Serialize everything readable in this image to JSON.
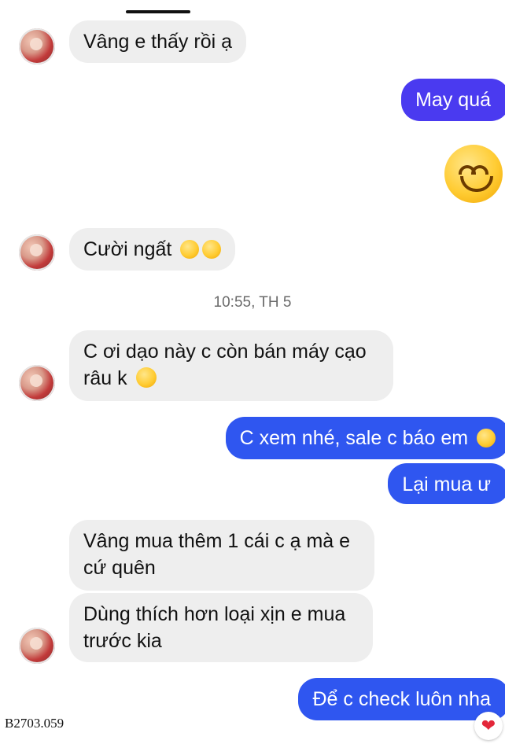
{
  "messages": {
    "m1": "Vâng e thấy rồi ạ",
    "m2": "May quá",
    "m3": "Cười ngất",
    "m4_line1": "C ơi dạo này c còn bán máy cạo",
    "m4_line2": "râu k",
    "m5": "C xem nhé, sale c báo em",
    "m6": "Lại mua ư",
    "m7_line1": "Vâng mua thêm 1 cái c ạ mà e",
    "m7_line2": "cứ quên",
    "m8_line1": "Dùng thích hơn loại xịn e mua",
    "m8_line2": "trước kia",
    "m9": "Để c check luôn nha"
  },
  "timestamp": "10:55, TH 5",
  "watermark": "B2703.059",
  "icons": {
    "big_reaction": "smiling-face-icon",
    "laugh": "laughing-face-icon",
    "sweat_smile": "sweat-smile-icon",
    "heart": "heart-icon"
  },
  "colors": {
    "incoming_bubble": "#eeeeee",
    "outgoing_purple": "#4a3af0",
    "outgoing_blue": "#2f56f0"
  }
}
